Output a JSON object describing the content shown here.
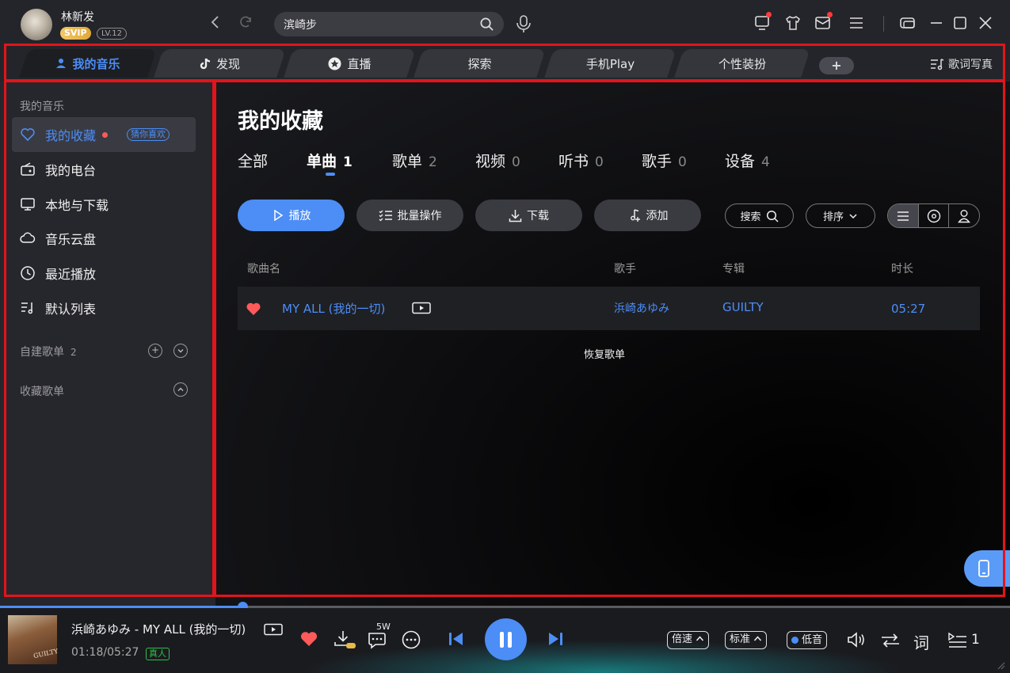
{
  "user": {
    "name": "林新发",
    "vip": "SVIP",
    "level": "LV.12"
  },
  "search": {
    "value": "滨崎步"
  },
  "tabs": [
    {
      "label": "我的音乐",
      "icon": "user-icon"
    },
    {
      "label": "发现",
      "icon": "tiktok-icon"
    },
    {
      "label": "直播",
      "icon": "star-icon"
    },
    {
      "label": "探索"
    },
    {
      "label": "手机Play"
    },
    {
      "label": "个性装扮"
    }
  ],
  "tab_add": "+",
  "lyrics_photo": "歌词写真",
  "sidebar": {
    "section_my": "我的音乐",
    "items": [
      {
        "label": "我的收藏",
        "tag": "猜你喜欢"
      },
      {
        "label": "我的电台"
      },
      {
        "label": "本地与下载"
      },
      {
        "label": "音乐云盘"
      },
      {
        "label": "最近播放"
      },
      {
        "label": "默认列表"
      }
    ],
    "created_playlists": {
      "label": "自建歌单",
      "count": "2"
    },
    "collected_playlists": {
      "label": "收藏歌单"
    }
  },
  "main": {
    "title": "我的收藏",
    "subtabs": [
      {
        "label": "全部",
        "count": ""
      },
      {
        "label": "单曲",
        "count": "1"
      },
      {
        "label": "歌单",
        "count": "2"
      },
      {
        "label": "视频",
        "count": "0"
      },
      {
        "label": "听书",
        "count": "0"
      },
      {
        "label": "歌手",
        "count": "0"
      },
      {
        "label": "设备",
        "count": "4"
      }
    ],
    "actions": {
      "play": "播放",
      "batch": "批量操作",
      "download": "下载",
      "add": "添加",
      "search": "搜索",
      "sort": "排序"
    },
    "columns": {
      "song": "歌曲名",
      "artist": "歌手",
      "album": "专辑",
      "duration": "时长"
    },
    "songs": [
      {
        "title": "MY ALL (我的一切)",
        "artist": "浜崎あゆみ",
        "album": "GUILTY",
        "duration": "05:27"
      }
    ],
    "restore": "恢复歌单"
  },
  "player": {
    "title": "浜崎あゆみ - MY ALL (我的一切)",
    "time": "01:18/05:27",
    "quality_tag": "真人",
    "cover_text": "GUILTY",
    "comment_count": "5W",
    "progress": 0.24,
    "speed": "倍速",
    "quality": "标准",
    "bass": "低音",
    "lyric": "词",
    "queue_count": "1"
  },
  "colors": {
    "accent": "#4c8df6",
    "frame": "#e3141b",
    "heart": "#ff5a5a"
  }
}
